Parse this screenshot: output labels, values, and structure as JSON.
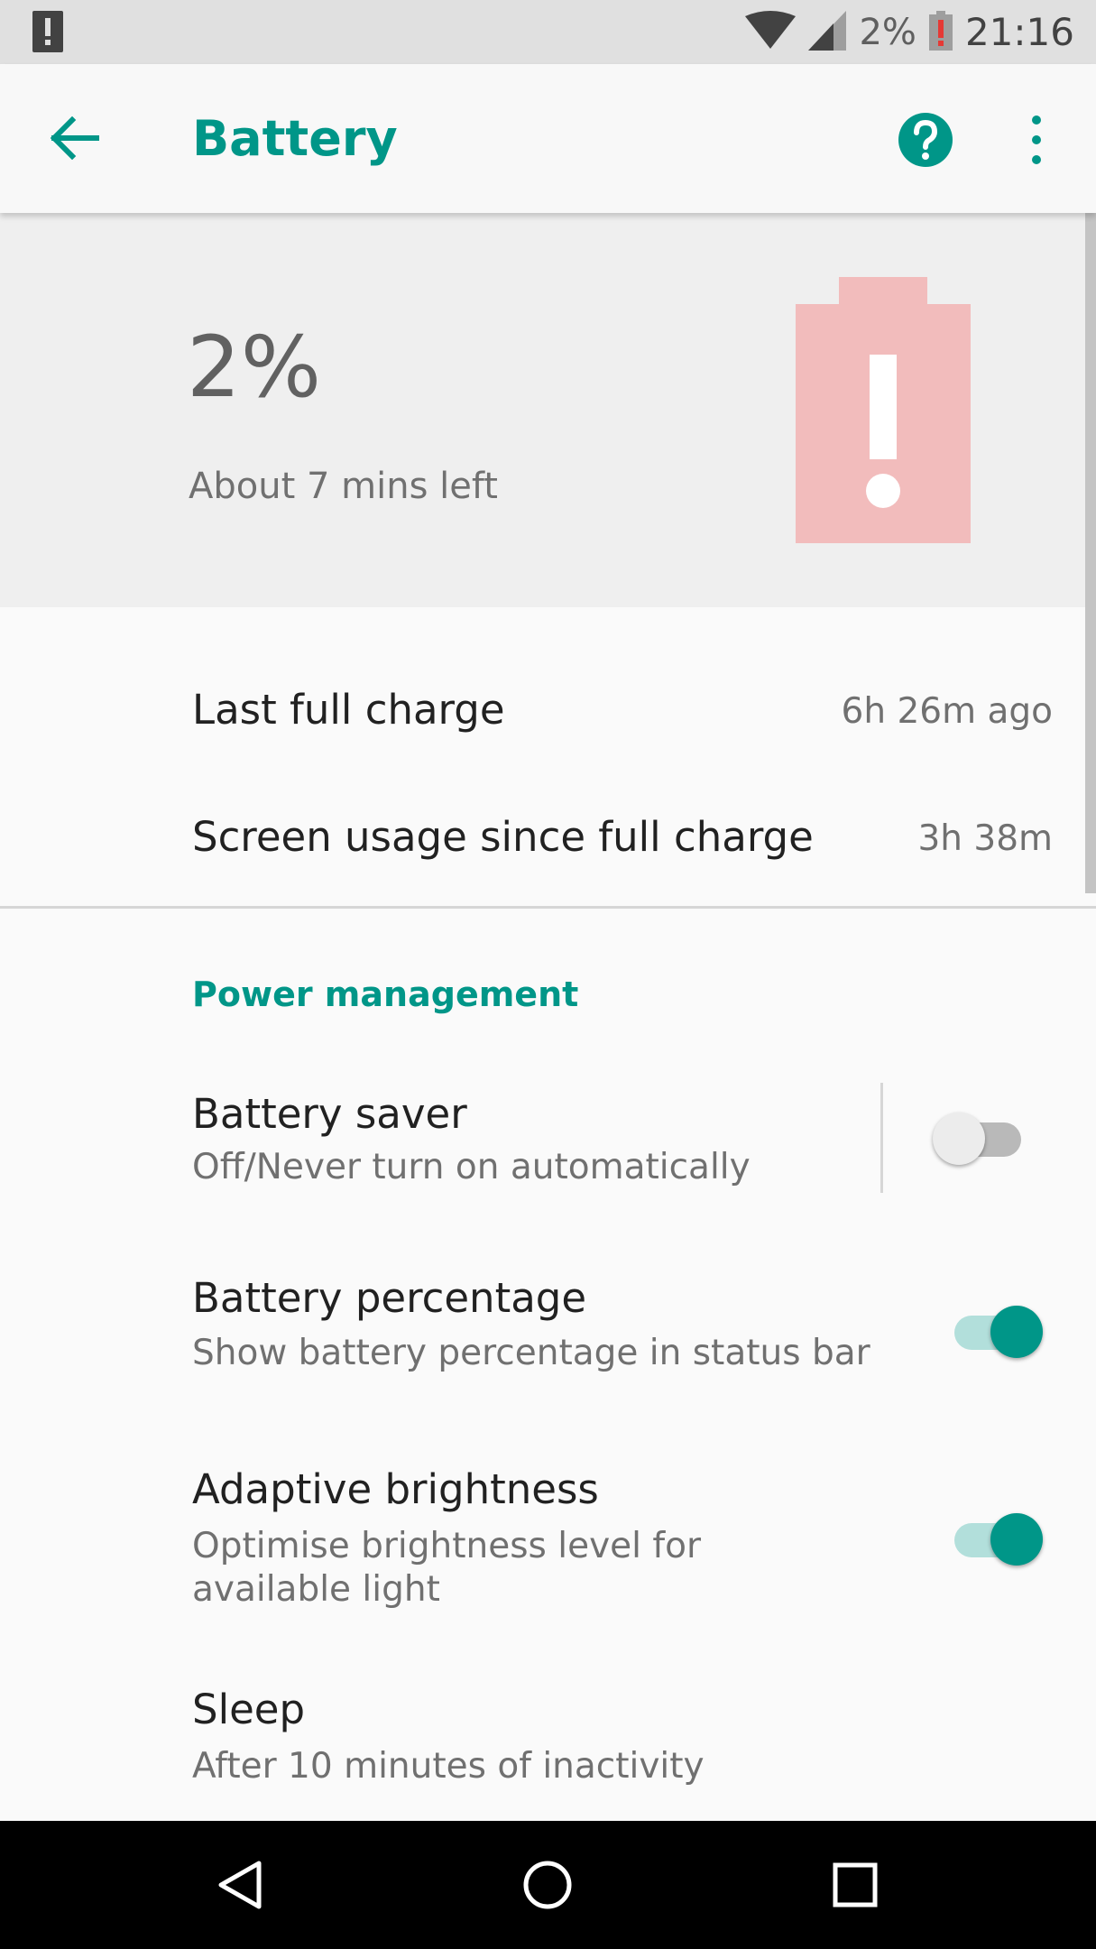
{
  "status_bar": {
    "battery_percent": "2%",
    "time": "21:16"
  },
  "toolbar": {
    "title": "Battery"
  },
  "battery_header": {
    "level": "2%",
    "remaining": "About 7 mins left"
  },
  "summary": {
    "last_full_charge": {
      "label": "Last full charge",
      "value": "6h 26m ago"
    },
    "screen_usage": {
      "label": "Screen usage since full charge",
      "value": "3h 38m"
    }
  },
  "power_management": {
    "header": "Power management",
    "items": [
      {
        "title": "Battery saver",
        "summary": "Off/Never turn on automatically",
        "enabled": false
      },
      {
        "title": "Battery percentage",
        "summary": "Show battery percentage in status bar",
        "enabled": true
      },
      {
        "title": "Adaptive brightness",
        "summary": "Optimise brightness level for available light",
        "enabled": true
      },
      {
        "title": "Sleep",
        "summary": "After 10 minutes of inactivity"
      }
    ]
  },
  "colors": {
    "accent": "#009688",
    "battery_warning": "#f2bcbc",
    "battery_alert_red": "#e53935"
  },
  "icons": {
    "status_left": "battery-alert-icon",
    "wifi": "wifi-icon",
    "signal": "cell-signal-icon",
    "status_battery": "battery-low-icon",
    "back": "arrow-back-icon",
    "help": "help-circle-icon",
    "more": "more-vert-icon",
    "nav_back": "nav-back-icon",
    "nav_home": "nav-home-icon",
    "nav_recents": "nav-recents-icon"
  }
}
